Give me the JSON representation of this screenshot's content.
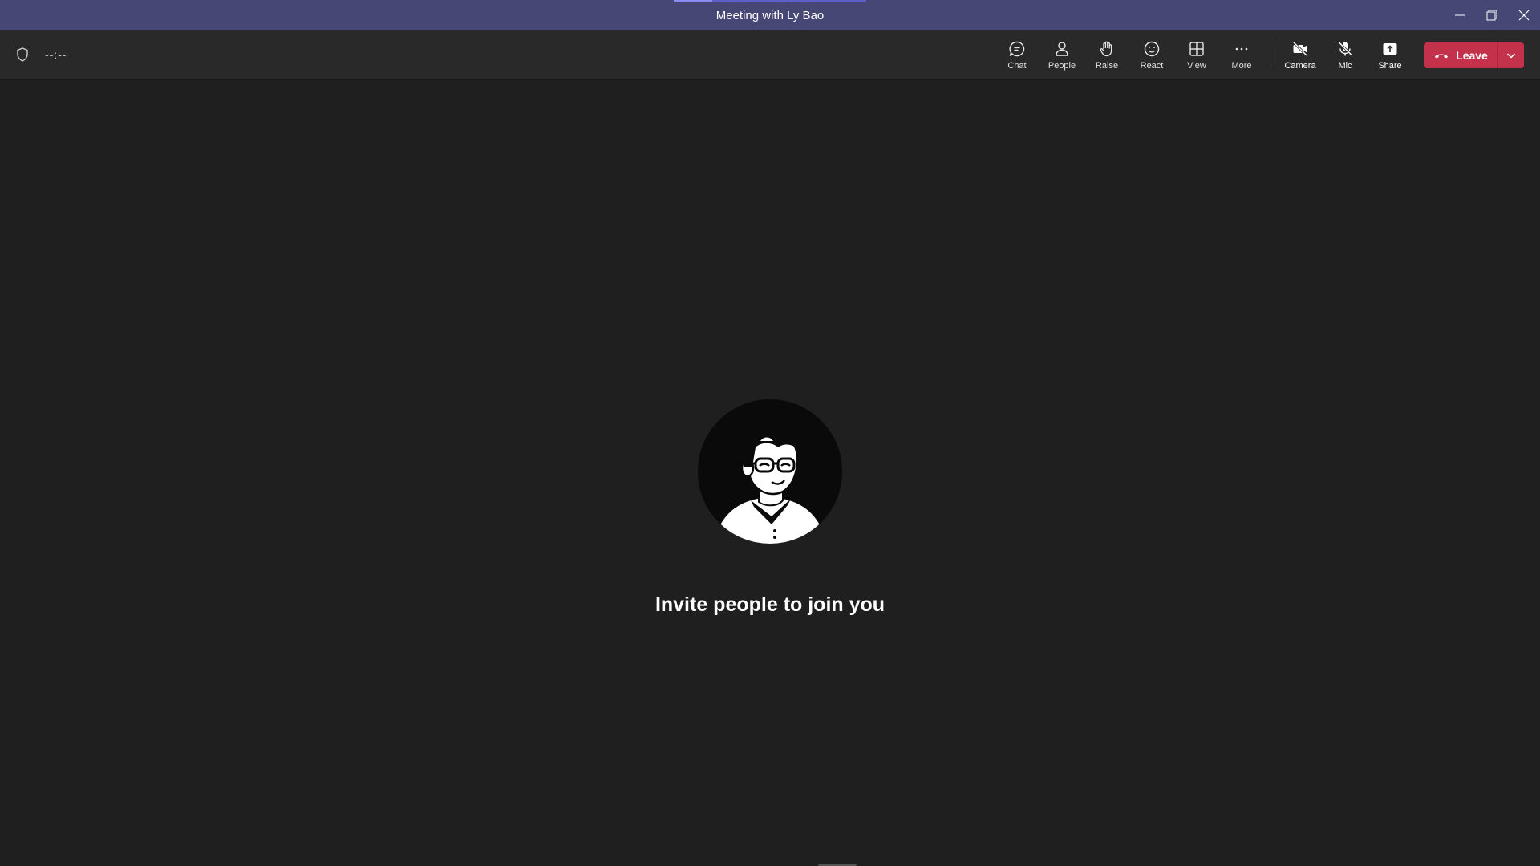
{
  "window": {
    "title": "Meeting with Ly Bao",
    "controls": [
      "minimize-icon",
      "restore-icon",
      "close-icon"
    ]
  },
  "toolbar": {
    "shield_icon": "shield-icon",
    "timer": "--:--",
    "tools": [
      {
        "label": "Chat",
        "icon": "chat-icon"
      },
      {
        "label": "People",
        "icon": "people-icon"
      },
      {
        "label": "Raise",
        "icon": "raise-hand-icon"
      },
      {
        "label": "React",
        "icon": "react-icon"
      },
      {
        "label": "View",
        "icon": "view-icon"
      },
      {
        "label": "More",
        "icon": "more-icon"
      }
    ],
    "media": [
      {
        "label": "Camera",
        "icon": "camera-off-icon"
      },
      {
        "label": "Mic",
        "icon": "mic-off-icon"
      },
      {
        "label": "Share",
        "icon": "share-icon"
      }
    ],
    "leave": {
      "label": "Leave",
      "icon": "hang-up-icon"
    }
  },
  "stage": {
    "message": "Invite people to join you",
    "avatar_icon": "avatar-illustration"
  },
  "colors": {
    "titlebar": "#464775",
    "toolbar": "#292929",
    "background": "#1f1f1f",
    "leave": "#c4314b"
  }
}
